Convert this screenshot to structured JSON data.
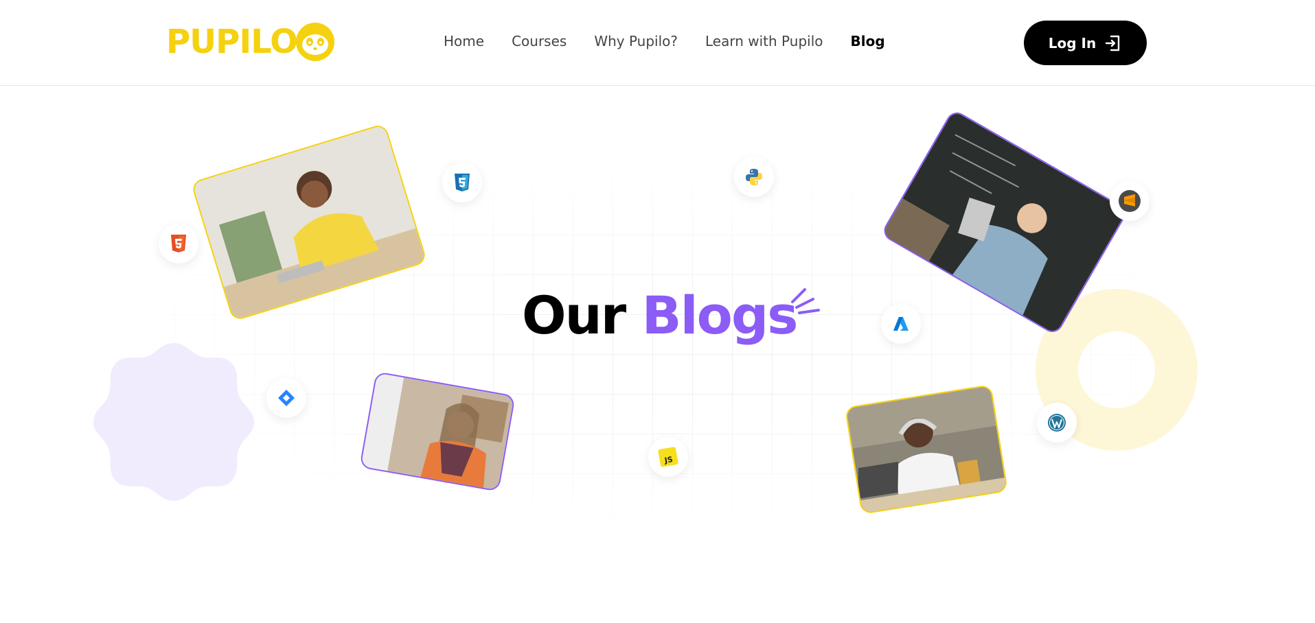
{
  "brand": {
    "logo_text": "PUPILO",
    "color": "#f5d10f"
  },
  "nav": {
    "items": [
      {
        "label": "Home",
        "active": false
      },
      {
        "label": "Courses",
        "active": false
      },
      {
        "label": "Why Pupilo?",
        "active": false
      },
      {
        "label": "Learn with Pupilo",
        "active": false
      },
      {
        "label": "Blog",
        "active": true
      }
    ]
  },
  "login": {
    "label": "Log In",
    "icon": "login-icon"
  },
  "hero": {
    "title_part1": "Our",
    "title_part2": "Blogs",
    "accent_color": "#8b5cf6"
  },
  "photos": [
    {
      "name": "student-yellow-shirt-photo",
      "border": "#f5d10f"
    },
    {
      "name": "student-tablet-classroom-photo",
      "border": "#8b5cf6"
    },
    {
      "name": "girl-writing-photo",
      "border": "#8b5cf6"
    },
    {
      "name": "boy-headphones-laptop-photo",
      "border": "#f5d10f"
    }
  ],
  "tech_badges": [
    {
      "icon": "html5-icon"
    },
    {
      "icon": "css3-icon"
    },
    {
      "icon": "python-icon"
    },
    {
      "icon": "sublime-text-icon"
    },
    {
      "icon": "azure-icon"
    },
    {
      "icon": "jira-icon"
    },
    {
      "icon": "javascript-icon"
    },
    {
      "icon": "wordpress-icon"
    }
  ]
}
